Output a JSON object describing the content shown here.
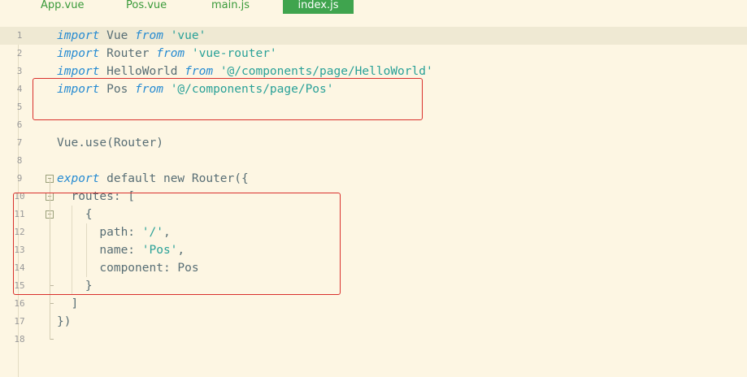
{
  "tabs": [
    {
      "label": "App.vue",
      "active": false
    },
    {
      "label": "Pos.vue",
      "active": false
    },
    {
      "label": "main.js",
      "active": false
    },
    {
      "label": "index.js",
      "active": true
    }
  ],
  "editor": {
    "line_numbers": [
      "1",
      "2",
      "3",
      "4",
      "5",
      "6",
      "7",
      "8",
      "9",
      "10",
      "11",
      "12",
      "13",
      "14",
      "15",
      "16",
      "17",
      "18"
    ],
    "lines": [
      {
        "a": "import",
        "b": " Vue ",
        "c": "from",
        "d": " ",
        "e": "'vue'"
      },
      {
        "a": "import",
        "b": " Router ",
        "c": "from",
        "d": " ",
        "e": "'vue-router'"
      },
      {
        "a": "import",
        "b": " HelloWorld ",
        "c": "from",
        "d": " ",
        "e": "'@/components/page/HelloWorld'"
      },
      {
        "a": "import",
        "b": " Pos ",
        "c": "from",
        "d": " ",
        "e": "'@/components/page/Pos'"
      },
      {
        "text": ""
      },
      {
        "text": ""
      },
      {
        "text": "Vue.use(Router)"
      },
      {
        "text": ""
      },
      {
        "a": "export",
        "b": " default new Router({"
      },
      {
        "text": "  routes: ["
      },
      {
        "text": "    {"
      },
      {
        "k": "      path: ",
        "v": "'/'",
        "t": ","
      },
      {
        "k": "      name: ",
        "v": "'Pos'",
        "t": ","
      },
      {
        "text": "      component: Pos"
      },
      {
        "text": "    }"
      },
      {
        "text": "  ]"
      },
      {
        "text": "})"
      },
      {
        "text": ""
      }
    ]
  },
  "colors": {
    "background": "#fdf6e3",
    "keyword": "#268bd2",
    "string": "#2aa198",
    "active_tab": "#3fa44e",
    "highlight_box": "#d9302c"
  },
  "icons": {
    "fold": "minus-box-icon"
  }
}
